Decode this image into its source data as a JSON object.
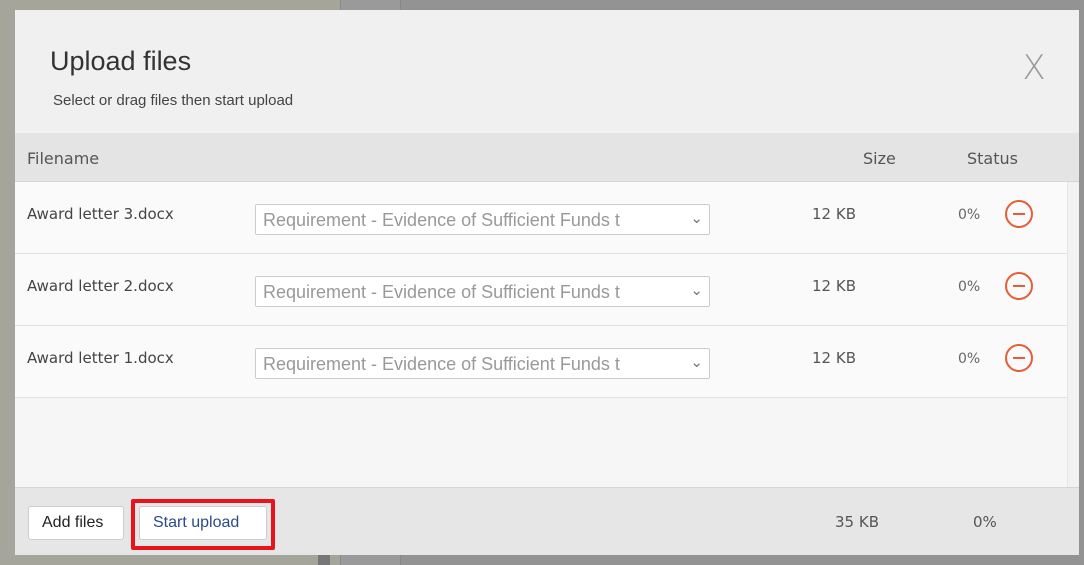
{
  "modal": {
    "title": "Upload files",
    "subtitle": "Select or drag files then start upload",
    "close_label": "X"
  },
  "table": {
    "columns": {
      "filename": "Filename",
      "size": "Size",
      "status": "Status"
    },
    "rows": [
      {
        "filename": "Award letter 3.docx",
        "category": "Requirement - Evidence of Sufficient Funds t",
        "size": "12 KB",
        "progress": "0%"
      },
      {
        "filename": "Award letter 2.docx",
        "category": "Requirement - Evidence of Sufficient Funds t",
        "size": "12 KB",
        "progress": "0%"
      },
      {
        "filename": "Award letter 1.docx",
        "category": "Requirement - Evidence of Sufficient Funds t",
        "size": "12 KB",
        "progress": "0%"
      }
    ]
  },
  "footer": {
    "add_files_label": "Add files",
    "start_upload_label": "Start upload",
    "total_size": "35 KB",
    "total_progress": "0%"
  },
  "icons": {
    "remove": "minus-circle-icon",
    "dropdown": "chevron-down-icon"
  },
  "colors": {
    "remove_accent": "#e55c3a",
    "highlight": "#e8141b",
    "link_text": "#2a4a8c"
  }
}
